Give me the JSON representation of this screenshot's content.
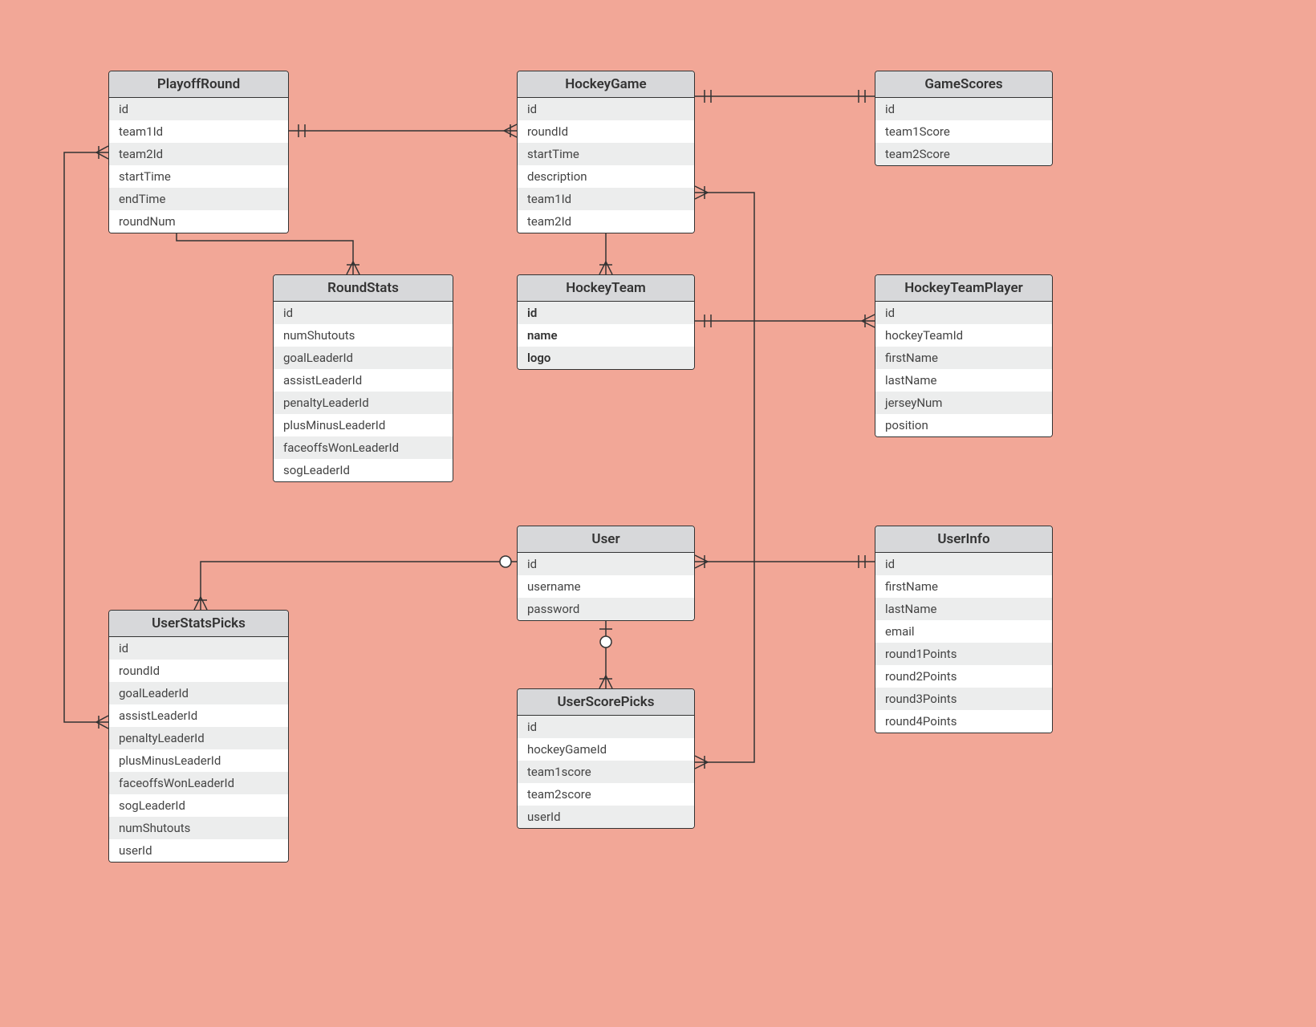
{
  "entities": {
    "playoffRound": {
      "title": "PlayoffRound",
      "fields": [
        "id",
        "team1Id",
        "team2Id",
        "startTime",
        "endTime",
        "roundNum"
      ]
    },
    "hockeyGame": {
      "title": "HockeyGame",
      "fields": [
        "id",
        "roundId",
        "startTime",
        "description",
        "team1Id",
        "team2Id"
      ]
    },
    "gameScores": {
      "title": "GameScores",
      "fields": [
        "id",
        "team1Score",
        "team2Score"
      ]
    },
    "roundStats": {
      "title": "RoundStats",
      "fields": [
        "id",
        "numShutouts",
        "goalLeaderId",
        "assistLeaderId",
        "penaltyLeaderId",
        "plusMinusLeaderId",
        "faceoffsWonLeaderId",
        "sogLeaderId"
      ]
    },
    "hockeyTeam": {
      "title": "HockeyTeam",
      "fields": [
        "id",
        "name",
        "logo"
      ]
    },
    "hockeyTeamPlayer": {
      "title": "HockeyTeamPlayer",
      "fields": [
        "id",
        "hockeyTeamId",
        "firstName",
        "lastName",
        "jerseyNum",
        "position"
      ]
    },
    "user": {
      "title": "User",
      "fields": [
        "id",
        "username",
        "password"
      ]
    },
    "userInfo": {
      "title": "UserInfo",
      "fields": [
        "id",
        "firstName",
        "lastName",
        "email",
        "round1Points",
        "round2Points",
        "round3Points",
        "round4Points"
      ]
    },
    "userStatsPicks": {
      "title": "UserStatsPicks",
      "fields": [
        "id",
        "roundId",
        "goalLeaderId",
        "assistLeaderId",
        "penaltyLeaderId",
        "plusMinusLeaderId",
        "faceoffsWonLeaderId",
        "sogLeaderId",
        "numShutouts",
        "userId"
      ]
    },
    "userScorePicks": {
      "title": "UserScorePicks",
      "fields": [
        "id",
        "hockeyGameId",
        "team1score",
        "team2score",
        "userId"
      ]
    }
  }
}
